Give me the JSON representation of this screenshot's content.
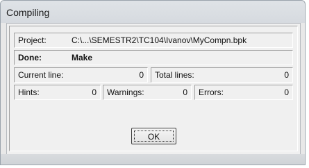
{
  "window": {
    "title": "Compiling"
  },
  "project": {
    "label": "Project:",
    "path": "C:\\...\\SEMESTR2\\TC104\\Ivanov\\MyCompn.bpk"
  },
  "status": {
    "label": "Done:",
    "value": "Make"
  },
  "lines": {
    "current_label": "Current line:",
    "current_value": "0",
    "total_label": "Total lines:",
    "total_value": "0"
  },
  "counts": {
    "hints_label": "Hints:",
    "hints_value": "0",
    "warnings_label": "Warnings:",
    "warnings_value": "0",
    "errors_label": "Errors:",
    "errors_value": "0"
  },
  "ok_button": {
    "label": "OK"
  }
}
